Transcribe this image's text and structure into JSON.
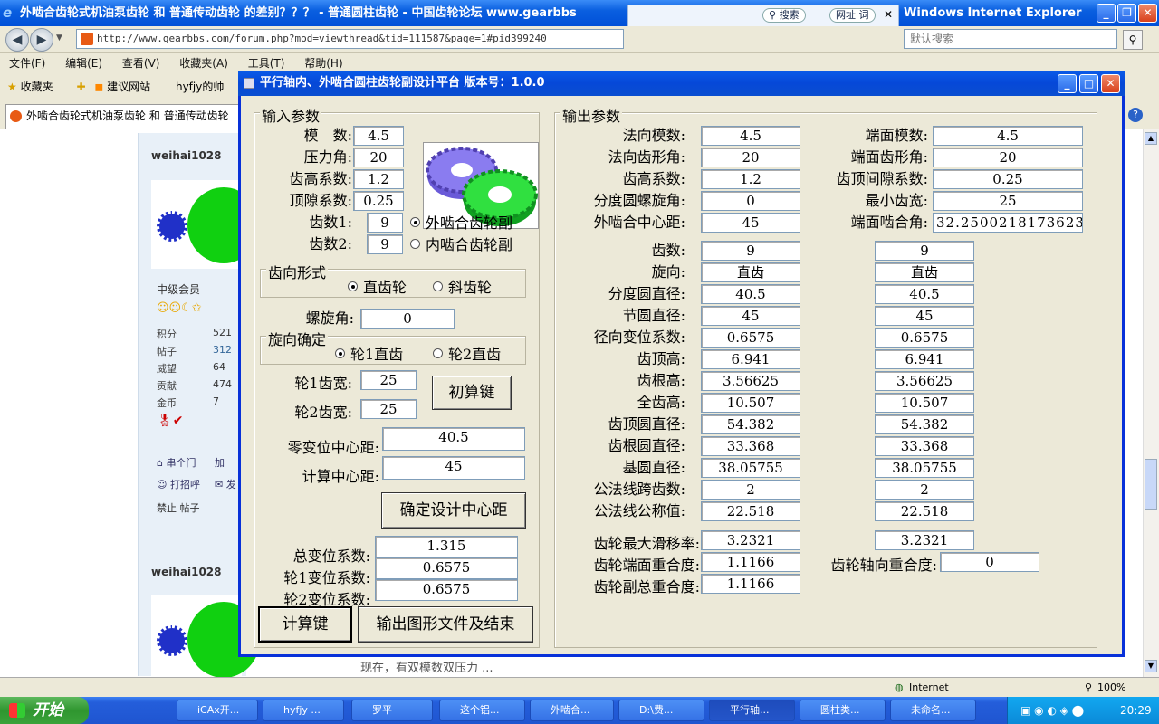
{
  "browser": {
    "title": "外啮合齿轮式机油泵齿轮 和 普通传动齿轮 的差别？？？ - 普通圆柱齿轮 - 中国齿轮论坛 www.gearbbs",
    "title_right": "Windows Internet Explorer",
    "url": "http://www.gearbbs.com/forum.php?mod=viewthread&tid=111587&page=1#pid399240",
    "search_popup": {
      "search_label": "搜索",
      "url_label": "网址",
      "word_label": "词"
    },
    "web_search_placeholder": "默认搜索",
    "menu": [
      "文件(F)",
      "编辑(E)",
      "查看(V)",
      "收藏夹(A)",
      "工具(T)",
      "帮助(H)"
    ],
    "favorites": {
      "label": "收藏夹",
      "suggest": "建议网站",
      "item": "hyfjy的帅"
    },
    "tab_title": "外啮合齿轮式机油泵齿轮 和 普通传动齿轮",
    "status": {
      "zone": "Internet",
      "zoom": "100%"
    }
  },
  "forum": {
    "user1": "weihai1028",
    "user2": "weihai1028",
    "rank": "中级会员",
    "stats": [
      {
        "label": "积分",
        "value": "521"
      },
      {
        "label": "帖子",
        "value": "312"
      },
      {
        "label": "威望",
        "value": "64"
      },
      {
        "label": "贡献",
        "value": "474"
      },
      {
        "label": "金币",
        "value": "7"
      }
    ],
    "actions": [
      "串个门",
      "加",
      "打招呼",
      "发"
    ],
    "ban": "禁止 帖子",
    "snippet": "现在，有双模数双压力 ..."
  },
  "dialog": {
    "title": "平行轴内、外啮合圆柱齿轮副设计平台 版本号：1.0.0",
    "input": {
      "group": "输入参数",
      "module_label": "模　数:",
      "module": "4.5",
      "pressure_label": "压力角:",
      "pressure": "20",
      "addendum_label": "齿高系数:",
      "addendum": "1.2",
      "clearance_label": "顶隙系数:",
      "clearance": "0.25",
      "z1_label": "齿数1:",
      "z1": "9",
      "z2_label": "齿数2:",
      "z2": "9",
      "mesh_external": "外啮合齿轮副",
      "mesh_internal": "内啮合齿轮副",
      "tooth_group": "齿向形式",
      "spur": "直齿轮",
      "helical": "斜齿轮",
      "helix_label": "螺旋角:",
      "helix": "0",
      "rot_group": "旋向确定",
      "rot1": "轮1直齿",
      "rot2": "轮2直齿",
      "w1_label": "轮1齿宽:",
      "w1": "25",
      "w2_label": "轮2齿宽:",
      "w2": "25",
      "init_btn": "初算键",
      "zero_cd_label": "零变位中心距:",
      "zero_cd": "40.5",
      "calc_cd_label": "计算中心距:",
      "calc_cd": "45",
      "confirm_btn": "确定设计中心距",
      "total_x_label": "总变位系数:",
      "total_x": "1.315",
      "x1_label": "轮1变位系数:",
      "x1": "0.6575",
      "x2_label": "轮2变位系数:",
      "x2": "0.6575",
      "calc_btn": "计算键",
      "export_btn": "输出图形文件及结束"
    },
    "output": {
      "group": "输出参数",
      "top_left": [
        {
          "label": "法向模数:",
          "value": "4.5"
        },
        {
          "label": "法向齿形角:",
          "value": "20"
        },
        {
          "label": "齿高系数:",
          "value": "1.2"
        },
        {
          "label": "分度圆螺旋角:",
          "value": "0"
        },
        {
          "label": "外啮合中心距:",
          "value": "45"
        }
      ],
      "top_right": [
        {
          "label": "端面模数:",
          "value": "4.5"
        },
        {
          "label": "端面齿形角:",
          "value": "20"
        },
        {
          "label": "齿顶间隙系数:",
          "value": "0.25"
        },
        {
          "label": "最小齿宽:",
          "value": "25"
        },
        {
          "label": "端面啮合角:",
          "value": "32.2500218173623"
        }
      ],
      "gear_rows": [
        {
          "label": "齿数:",
          "g1": "9",
          "g2": "9"
        },
        {
          "label": "旋向:",
          "g1": "直齿",
          "g2": "直齿"
        },
        {
          "label": "分度圆直径:",
          "g1": "40.5",
          "g2": "40.5"
        },
        {
          "label": "节圆直径:",
          "g1": "45",
          "g2": "45"
        },
        {
          "label": "径向变位系数:",
          "g1": "0.6575",
          "g2": "0.6575"
        },
        {
          "label": "齿顶高:",
          "g1": "6.941",
          "g2": "6.941"
        },
        {
          "label": "齿根高:",
          "g1": "3.56625",
          "g2": "3.56625"
        },
        {
          "label": "全齿高:",
          "g1": "10.507",
          "g2": "10.507"
        },
        {
          "label": "齿顶圆直径:",
          "g1": "54.382",
          "g2": "54.382"
        },
        {
          "label": "齿根圆直径:",
          "g1": "33.368",
          "g2": "33.368"
        },
        {
          "label": "基圆直径:",
          "g1": "38.05755",
          "g2": "38.05755"
        },
        {
          "label": "公法线跨齿数:",
          "g1": "2",
          "g2": "2"
        },
        {
          "label": "公法线公称值:",
          "g1": "22.518",
          "g2": "22.518"
        }
      ],
      "slip_label": "齿轮最大滑移率:",
      "slip1": "3.2321",
      "slip2": "3.2321",
      "face_contact_label": "齿轮端面重合度:",
      "face_contact": "1.1166",
      "axial_contact_label": "齿轮轴向重合度:",
      "axial_contact": "0",
      "total_contact_label": "齿轮副总重合度:",
      "total_contact": "1.1166"
    }
  },
  "taskbar": {
    "start": "开始",
    "tasks": [
      "iCAx开...",
      "hyfjy ...",
      "罗平",
      "这个铝...",
      "外啮合...",
      "D:\\费...",
      "平行轴...",
      "圆柱类...",
      "未命名..."
    ],
    "clock": "20:29"
  }
}
